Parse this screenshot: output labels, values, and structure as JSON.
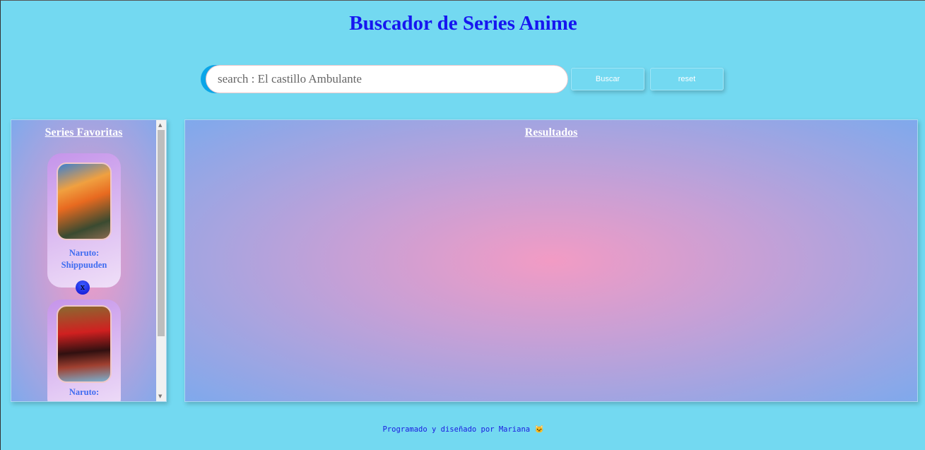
{
  "header": {
    "title": "Buscador de Series Anime"
  },
  "search": {
    "placeholder": "search : El castillo Ambulante",
    "buscar_label": "Buscar",
    "reset_label": "reset"
  },
  "favorites": {
    "title": "Series Favoritas",
    "remove_label": "x",
    "items": [
      {
        "title": "Naruto: Shippuuden"
      },
      {
        "title": "Naruto:"
      }
    ]
  },
  "results": {
    "title": "Resultados"
  },
  "footer": {
    "text": "Programado y diseñado por Mariana",
    "icon": "github-icon"
  }
}
